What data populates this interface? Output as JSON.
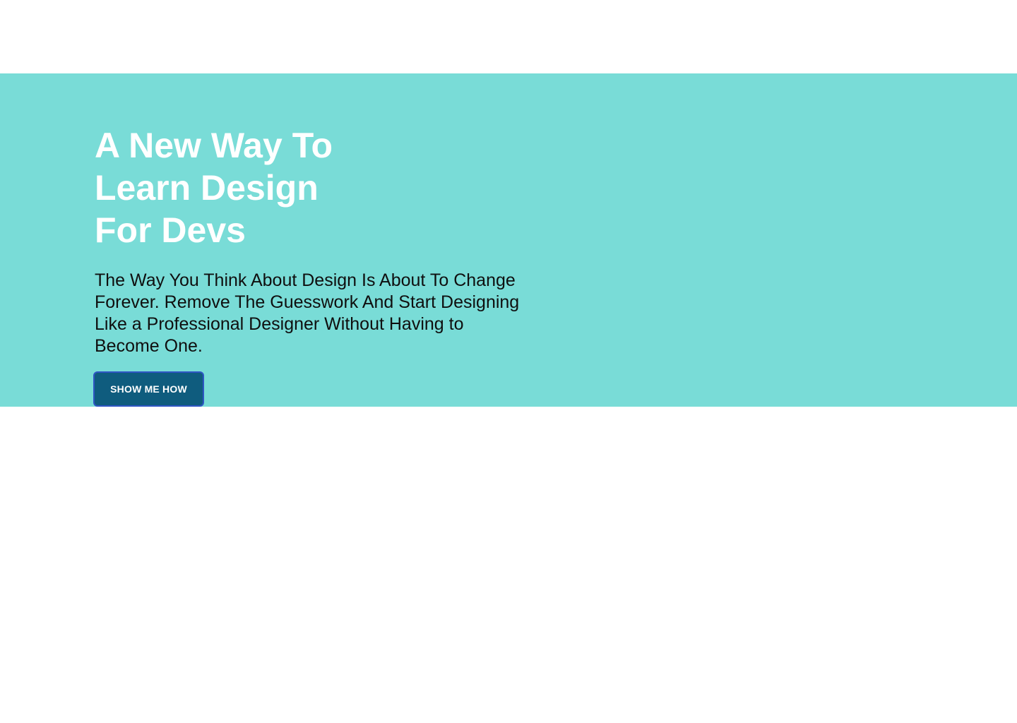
{
  "hero": {
    "title_lines": [
      "A New Way To",
      "Learn Design",
      "For Devs"
    ],
    "subtitle": "The Way You Think About Design Is About To Change Forever. Remove The Guesswork And Start Designing Like a Professional Designer Without Having to Become One.",
    "cta_label": "SHOW ME HOW"
  },
  "colors": {
    "hero_background": "#79dcd7",
    "title_text": "#ffffff",
    "subtitle_text": "#0f0f0f",
    "button_background": "#0f5c7e",
    "button_border": "#2f56c4",
    "page_background": "#ffffff"
  }
}
